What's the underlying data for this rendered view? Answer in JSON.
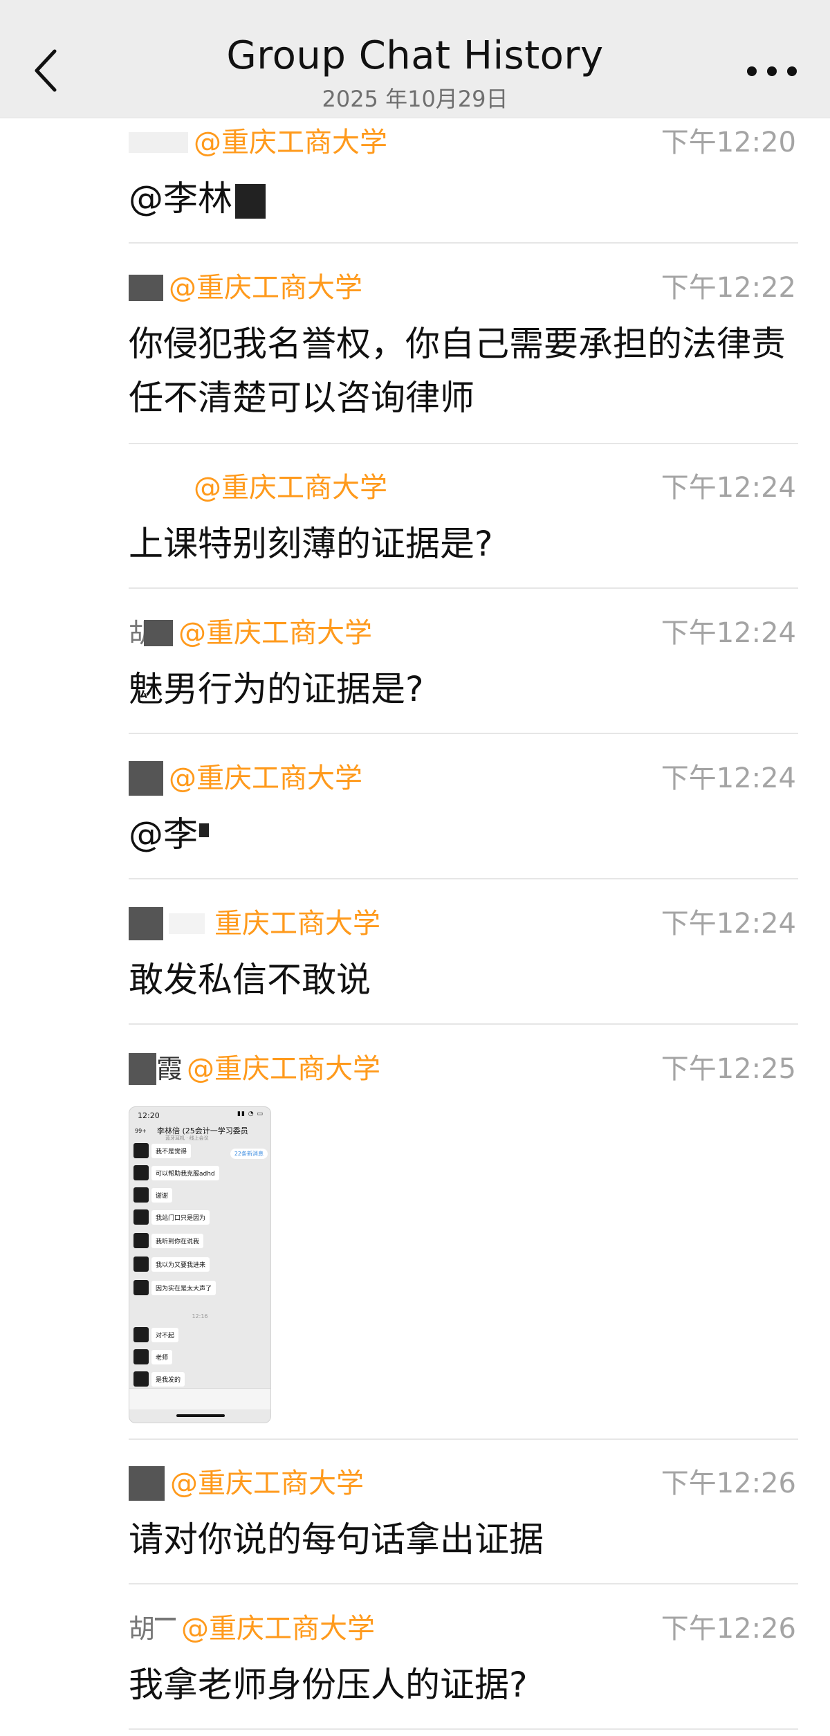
{
  "header": {
    "title": "Group Chat History",
    "date": "2025 年10月29日"
  },
  "messages": [
    {
      "name_suffix": "@重庆工商大学",
      "time": "下午12:20",
      "text": "@李林"
    },
    {
      "name_suffix": "@重庆工商大学",
      "time": "下午12:22",
      "text": "你侵犯我名誉权，你自己需要承担的法律责任不清楚可以咨询律师"
    },
    {
      "name_suffix": "@重庆工商大学",
      "time": "下午12:24",
      "text": "上课特别刻薄的证据是?"
    },
    {
      "name_stub": "胡",
      "name_suffix": "@重庆工商大学",
      "time": "下午12:24",
      "text": "魅男行为的证据是?"
    },
    {
      "name_suffix": "@重庆工商大学",
      "time": "下午12:24",
      "text": "@李"
    },
    {
      "name_suffix": "重庆工商大学",
      "time": "下午12:24",
      "text": "敢发私信不敢说"
    },
    {
      "name_stub": "霞",
      "name_suffix": "@重庆工商大学",
      "time": "下午12:25"
    },
    {
      "name_suffix": "@重庆工商大学",
      "time": "下午12:26",
      "text": "请对你说的每句话拿出证据"
    },
    {
      "name_stub": "胡",
      "name_suffix": "@重庆工商大学",
      "time": "下午12:26",
      "text": "我拿老师身份压人的证据?"
    }
  ],
  "screenshot": {
    "status_time": "12:20",
    "chat_title": "李林倍 (25会计一学习委员",
    "chat_subtitle": "蓝牙耳机 · 线上会议",
    "back_count": "99+",
    "unread_label": "22条新消息",
    "bubbles": [
      "我不是觉得",
      "可以帮助我克服adhd",
      "谢谢",
      "我站门口只是因为",
      "我听到你在说我",
      "我以为又要我进来",
      "因为实在是太大声了",
      "对不起",
      "老师",
      "是我发的"
    ],
    "stamp": "12:16"
  }
}
